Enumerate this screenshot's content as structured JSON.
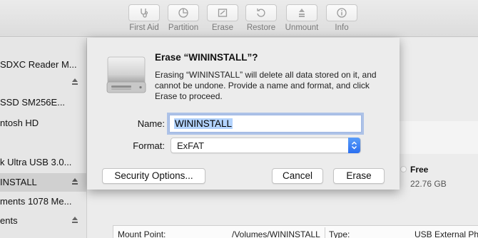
{
  "toolbar": {
    "items": [
      {
        "label": "First Aid",
        "icon": "stethoscope-icon"
      },
      {
        "label": "Partition",
        "icon": "pie-chart-icon"
      },
      {
        "label": "Erase",
        "icon": "eraser-icon"
      },
      {
        "label": "Restore",
        "icon": "restore-icon"
      },
      {
        "label": "Unmount",
        "icon": "unmount-icon"
      },
      {
        "label": "Info",
        "icon": "info-icon"
      }
    ]
  },
  "sidebar": {
    "items": [
      {
        "label": "SDXC Reader M..."
      },
      {
        "label": ""
      },
      {
        "label": "SSD SM256E..."
      },
      {
        "label": "ntosh HD"
      },
      {
        "label": "k Ultra USB 3.0..."
      },
      {
        "label": "INSTALL"
      },
      {
        "label": "ments 1078 Me..."
      },
      {
        "label": "ents"
      }
    ]
  },
  "dialog": {
    "title": "Erase “WININSTALL”?",
    "message": "Erasing “WININSTALL” will delete all data stored on it, and cannot be undone. Provide a name and format, and click Erase to proceed.",
    "name_label": "Name:",
    "name_value": "WININSTALL",
    "format_label": "Format:",
    "format_value": "ExFAT",
    "security_button": "Security Options...",
    "cancel_button": "Cancel",
    "erase_button": "Erase"
  },
  "volume_info": {
    "free_label": "Free",
    "free_value": "22.76 GB",
    "mount_point_label": "Mount Point:",
    "mount_point_value": "/Volumes/WININSTALL",
    "type_label": "Type:",
    "type_value": "USB External Phy"
  },
  "colors": {
    "accent": "#2b6ff0",
    "selection": "#b3d3fd"
  }
}
